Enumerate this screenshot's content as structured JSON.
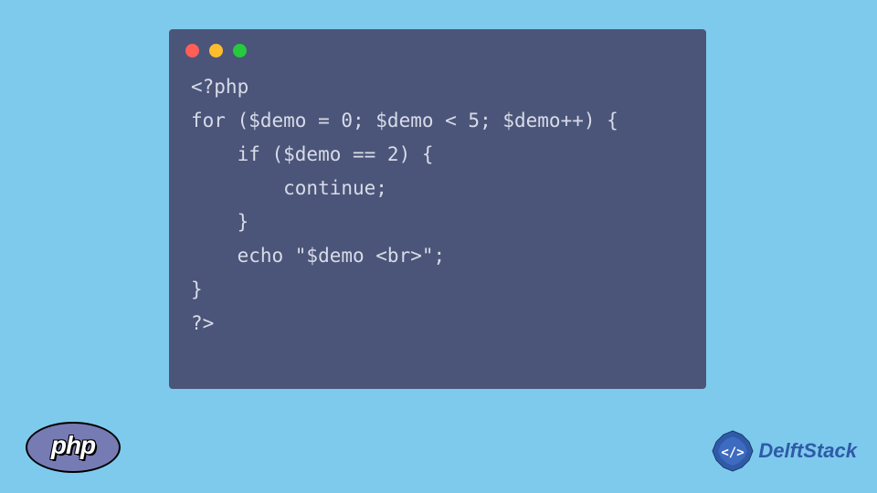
{
  "code": {
    "lines": [
      "<?php",
      "for ($demo = 0; $demo < 5; $demo++) {",
      "    if ($demo == 2) {",
      "        continue;",
      "    }",
      "    echo \"$demo <br>\";",
      "}",
      "?>"
    ]
  },
  "logos": {
    "php_text": "php",
    "delftstack_text": "DelftStack",
    "delftstack_badge": "</>"
  },
  "colors": {
    "background": "#7ecaed",
    "window": "#4b5579",
    "window_text": "#d8dce8",
    "php_purple": "#777bb3",
    "delftstack_blue": "#2f5aa8"
  }
}
